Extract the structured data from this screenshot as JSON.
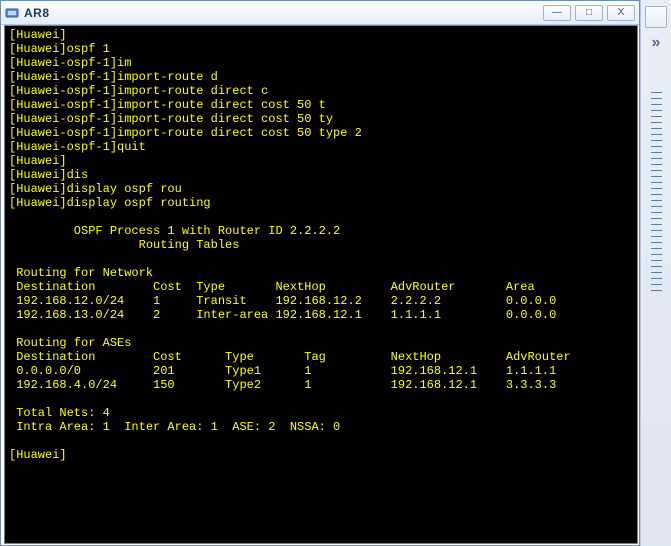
{
  "window": {
    "title": "AR8"
  },
  "titlebar": {
    "min": "—",
    "max": "□",
    "close": "X"
  },
  "terminal": {
    "lines": [
      "[Huawei]",
      "[Huawei]ospf 1",
      "[Huawei-ospf-1]im",
      "[Huawei-ospf-1]import-route d",
      "[Huawei-ospf-1]import-route direct c",
      "[Huawei-ospf-1]import-route direct cost 50 t",
      "[Huawei-ospf-1]import-route direct cost 50 ty",
      "[Huawei-ospf-1]import-route direct cost 50 type 2",
      "[Huawei-ospf-1]quit",
      "[Huawei]",
      "[Huawei]dis",
      "[Huawei]display ospf rou",
      "[Huawei]display ospf routing",
      "",
      "\t OSPF Process 1 with Router ID 2.2.2.2",
      "\t\t  Routing Tables",
      "",
      " Routing for Network",
      " Destination        Cost  Type       NextHop         AdvRouter       Area",
      " 192.168.12.0/24    1     Transit    192.168.12.2    2.2.2.2         0.0.0.0",
      " 192.168.13.0/24    2     Inter-area 192.168.12.1    1.1.1.1         0.0.0.0",
      "",
      " Routing for ASEs",
      " Destination        Cost      Type       Tag         NextHop         AdvRouter",
      " 0.0.0.0/0          201       Type1      1           192.168.12.1    1.1.1.1",
      " 192.168.4.0/24     150       Type2      1           192.168.12.1    3.3.3.3",
      "",
      " Total Nets: 4",
      " Intra Area: 1  Inter Area: 1  ASE: 2  NSSA: 0",
      "",
      "[Huawei]"
    ]
  },
  "chart_data": {
    "type": "table",
    "ospf": {
      "process_id": 1,
      "router_id": "2.2.2.2"
    },
    "network_routes": {
      "columns": [
        "Destination",
        "Cost",
        "Type",
        "NextHop",
        "AdvRouter",
        "Area"
      ],
      "rows": [
        [
          "192.168.12.0/24",
          1,
          "Transit",
          "192.168.12.2",
          "2.2.2.2",
          "0.0.0.0"
        ],
        [
          "192.168.13.0/24",
          2,
          "Inter-area",
          "192.168.12.1",
          "1.1.1.1",
          "0.0.0.0"
        ]
      ]
    },
    "ase_routes": {
      "columns": [
        "Destination",
        "Cost",
        "Type",
        "Tag",
        "NextHop",
        "AdvRouter"
      ],
      "rows": [
        [
          "0.0.0.0/0",
          201,
          "Type1",
          1,
          "192.168.12.1",
          "1.1.1.1"
        ],
        [
          "192.168.4.0/24",
          150,
          "Type2",
          1,
          "192.168.12.1",
          "3.3.3.3"
        ]
      ]
    },
    "totals": {
      "Total Nets": 4,
      "Intra Area": 1,
      "Inter Area": 1,
      "ASE": 2,
      "NSSA": 0
    }
  }
}
